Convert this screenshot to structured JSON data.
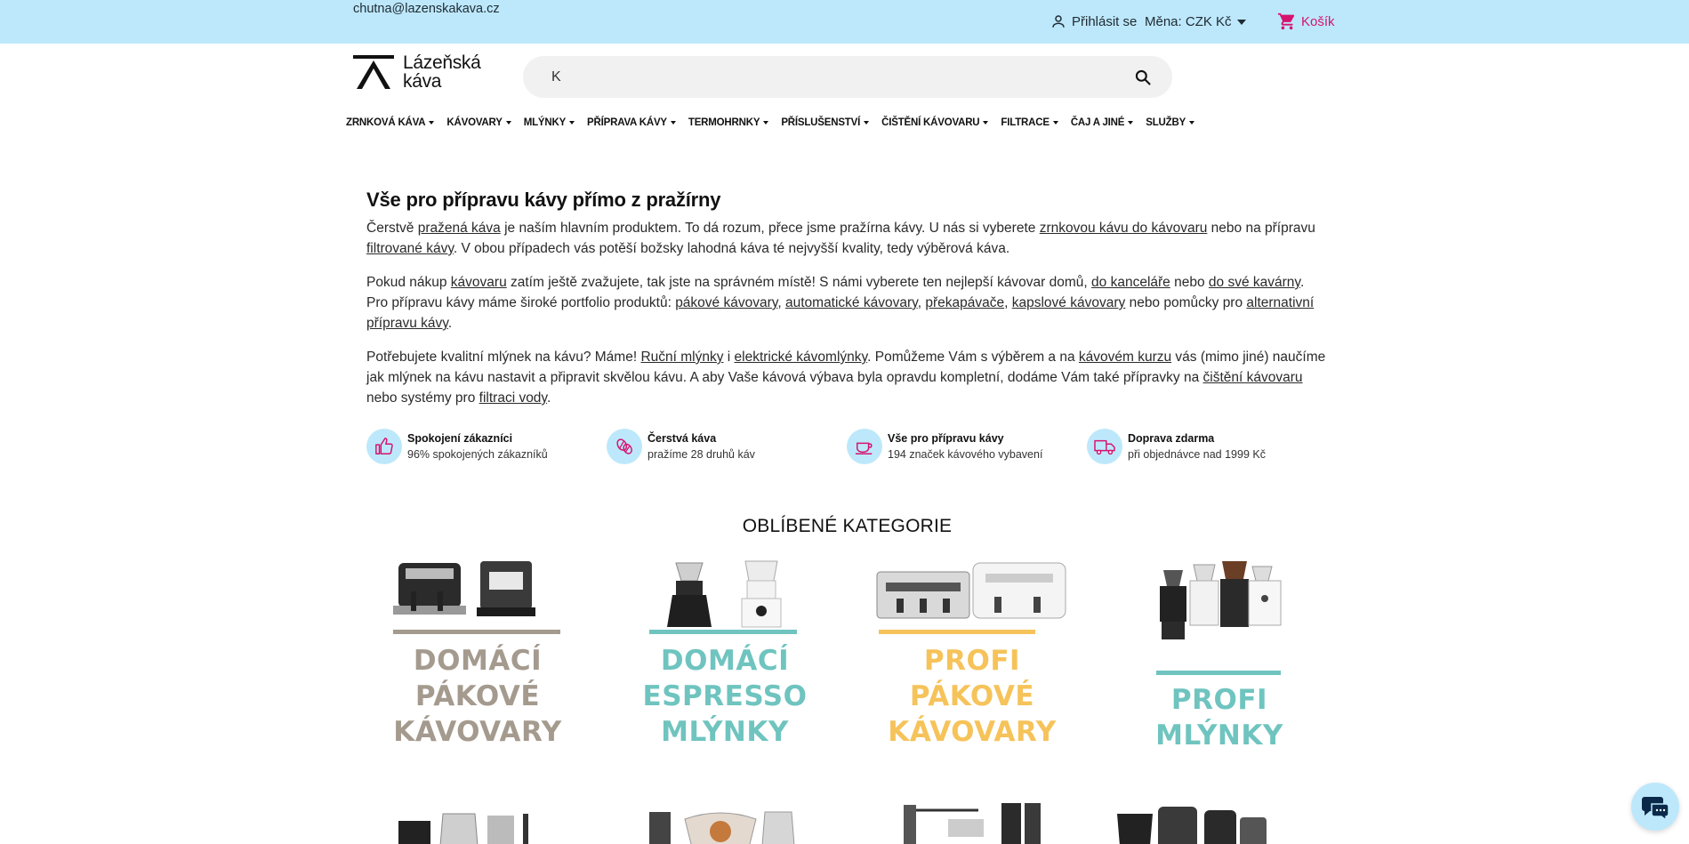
{
  "topbar": {
    "email": "chutna@lazenskakava.cz",
    "login_label": "Přihlásit se",
    "currency_label": "Měna: CZK Kč",
    "cart_label": "Košík",
    "cart_color": "#d6136e",
    "bar_color": "#bde8fb"
  },
  "header": {
    "logo_line1": "Lázeňská",
    "logo_line2": "káva",
    "search_value": "K",
    "search_icon": "search-icon"
  },
  "nav": {
    "items": [
      {
        "label": "ZRNKOVÁ KÁVA"
      },
      {
        "label": "KÁVOVARY"
      },
      {
        "label": "MLÝNKY"
      },
      {
        "label": "PŘÍPRAVA KÁVY"
      },
      {
        "label": "TERMOHRNKY"
      },
      {
        "label": "PŘÍSLUŠENSTVÍ"
      },
      {
        "label": "ČIŠTĚNÍ KÁVOVARU"
      },
      {
        "label": "FILTRACE"
      },
      {
        "label": "ČAJ A JINÉ"
      },
      {
        "label": "SLUŽBY"
      }
    ]
  },
  "intro": {
    "title": "Vše pro přípravu kávy přímo z pražírny",
    "p1": {
      "t1": "Čerstvě ",
      "l1": "pražená káva",
      "t2": " je naším hlavním produktem. To dá rozum, přece jsme pražírna kávy. U nás si vyberete ",
      "l2": "zrnkovou kávu do kávovaru",
      "t3": " nebo na přípravu ",
      "l3": "filtrované kávy",
      "t4": ". V obou případech vás potěší božsky lahodná káva té nejvyšší kvality, tedy výběrová káva."
    },
    "p2": {
      "t1": "Pokud nákup ",
      "l1": "kávovaru",
      "t2": " zatím ještě zvažujete, tak jste na správném místě! S námi vyberete ten nejlepší kávovar domů, ",
      "l2": "do kanceláře",
      "t3": " nebo ",
      "l3": "do své kavárny",
      "t4": ". Pro přípravu kávy máme široké portfolio produktů: ",
      "l4": "pákové kávovary",
      "t5": ", ",
      "l5": "automatické kávovary",
      "t6": ", ",
      "l6": "překapávače",
      "t7": ", ",
      "l7": "kapslové kávovary",
      "t8": " nebo pomůcky pro ",
      "l8": "alternativní přípravu kávy",
      "t9": "."
    },
    "p3": {
      "t1": "Potřebujete kvalitní mlýnek na kávu? Máme! ",
      "l1": "Ruční mlýnky",
      "t2": " i ",
      "l2": "elektrické kávomlýnky",
      "t3": ". Pomůžeme Vám s výběrem a na ",
      "l3": "kávovém kurzu",
      "t4": " vás (mimo jiné) naučíme jak mlýnek na kávu nastavit a připravit skvělou kávu. A aby Vaše kávová výbava byla opravdu kompletní, dodáme Vám také přípravky na ",
      "l4": "čištění kávovaru",
      "t5": " nebo systémy pro ",
      "l5": "filtraci vody",
      "t6": "."
    }
  },
  "benefits": [
    {
      "icon": "thumbs-up-icon",
      "title": "Spokojení zákazníci",
      "subtitle": "96% spokojených zákazníků"
    },
    {
      "icon": "coffee-beans-icon",
      "title": "Čerstvá káva",
      "subtitle": "pražíme 28 druhů káv"
    },
    {
      "icon": "coffee-cup-icon",
      "title": "Vše pro přípravu kávy",
      "subtitle": "194 značek kávového vybavení"
    },
    {
      "icon": "delivery-truck-icon",
      "title": "Doprava zdarma",
      "subtitle": "při objednávce nad 1999 Kč"
    }
  ],
  "categories": {
    "heading": "OBLÍBENÉ KATEGORIE",
    "items": [
      {
        "line1": "DOMÁCÍ",
        "line2": "PÁKOVÉ",
        "line3": "KÁVOVARY",
        "color": "#a49a8e"
      },
      {
        "line1": "DOMÁCÍ",
        "line2": "ESPRESSO",
        "line3": "MLÝNKY",
        "color": "#6fc4bf"
      },
      {
        "line1": "PROFI",
        "line2": "PÁKOVÉ",
        "line3": "KÁVOVARY",
        "color": "#f6c35a"
      },
      {
        "line1": "PROFI",
        "line2": "MLÝNKY",
        "color": "#6fc4bf"
      }
    ]
  },
  "chat": {
    "icon": "chat-icon"
  }
}
